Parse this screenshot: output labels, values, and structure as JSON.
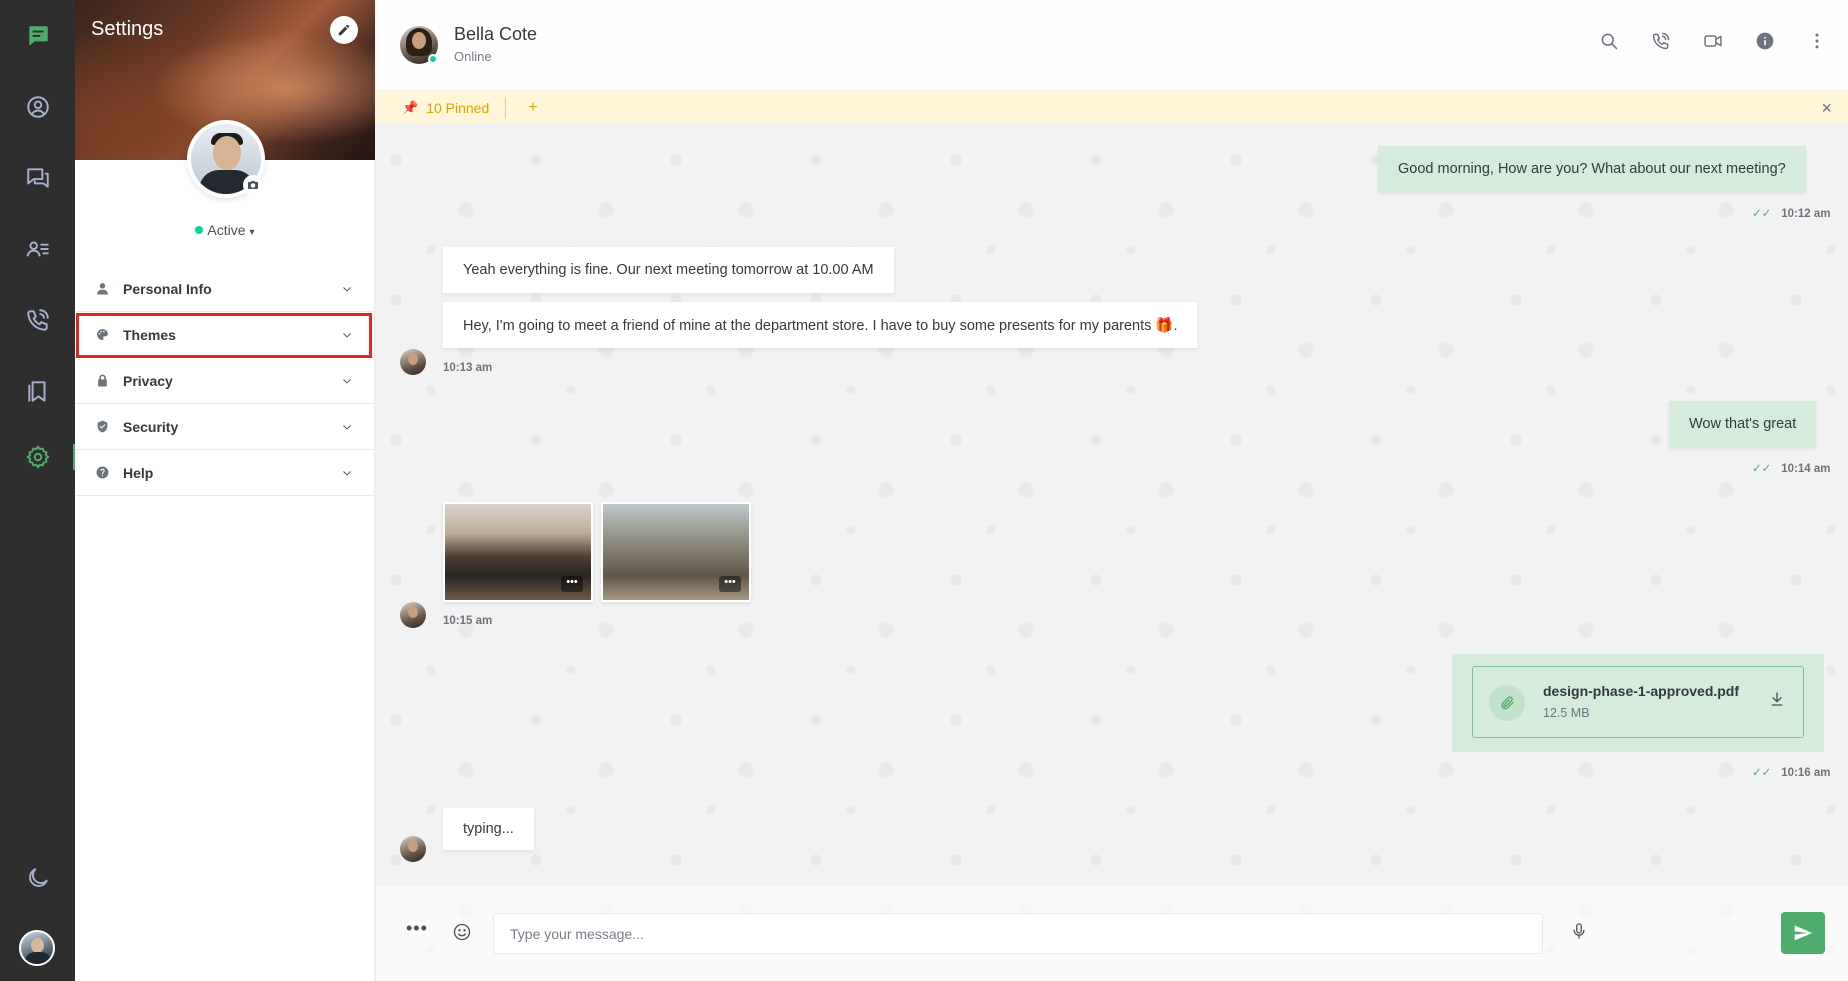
{
  "settings": {
    "title": "Settings",
    "status": "Active",
    "menu": [
      {
        "label": "Personal Info",
        "icon": "user-icon"
      },
      {
        "label": "Themes",
        "icon": "palette-icon"
      },
      {
        "label": "Privacy",
        "icon": "lock-icon"
      },
      {
        "label": "Security",
        "icon": "shield-icon"
      },
      {
        "label": "Help",
        "icon": "help-circle-icon"
      }
    ]
  },
  "chat": {
    "contact_name": "Bella Cote",
    "contact_status": "Online",
    "pinned_label": "10 Pinned",
    "pinned_add": "+",
    "messages": {
      "m1": {
        "text": "Good morning, How are you? What about our next meeting?",
        "time": "10:12 am"
      },
      "m2": {
        "text": "Yeah everything is fine. Our next meeting tomorrow at 10.00 AM"
      },
      "m3": {
        "text": "Hey, I'm going to meet a friend of mine at the department store. I have to buy some presents for my parents 🎁.",
        "time": "10:13 am"
      },
      "m4": {
        "text": "Wow that's great",
        "time": "10:14 am"
      },
      "m5": {
        "time": "10:15 am"
      },
      "m6": {
        "file_name": "design-phase-1-approved.pdf",
        "file_size": "12.5 MB",
        "time": "10:16 am"
      },
      "m7": {
        "text": "typing..."
      }
    },
    "composer": {
      "placeholder": "Type your message..."
    }
  },
  "colors": {
    "accent": "#4eac6d",
    "rail_bg": "#2e2e2e",
    "online": "#06d6a0",
    "highlight": "#e0262a",
    "pinned_bg": "#fff6d9"
  }
}
